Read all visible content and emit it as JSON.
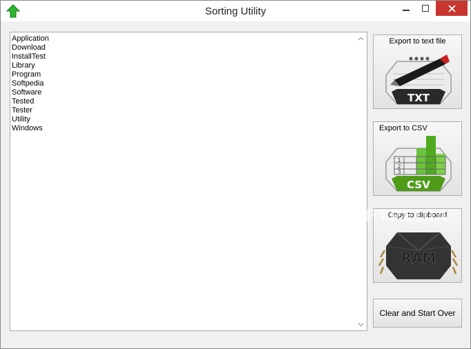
{
  "window": {
    "title": "Sorting Utility"
  },
  "list": {
    "items": [
      "Application",
      "Download",
      "InstallTest",
      "Library",
      "Program",
      "Softpedia",
      "Software",
      "Tested",
      "Tester",
      "Utility",
      "Windows"
    ]
  },
  "buttons": {
    "export_txt": "Export to text file",
    "export_csv": "Export to CSV",
    "copy_clipboard": "Copy to clipboard",
    "clear": "Clear and Start Over"
  },
  "badges": {
    "txt": "TXT",
    "csv": "CSV",
    "ram": "RAM",
    "csv_rows": [
      "1",
      "2",
      "3"
    ]
  },
  "watermark": "SOFTPEDIA",
  "colors": {
    "close_button": "#c7372f",
    "csv_green": "#5fb31f",
    "title_text": "#222222"
  }
}
